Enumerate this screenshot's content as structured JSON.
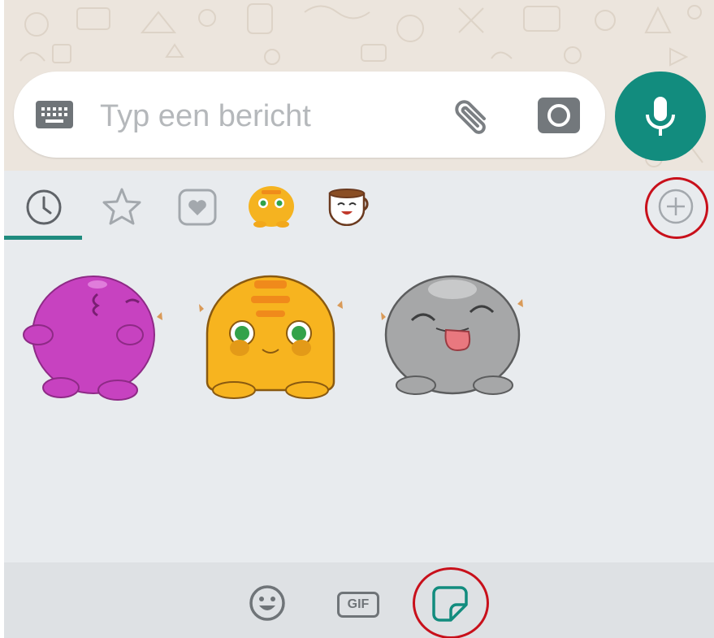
{
  "composer": {
    "placeholder": "Typ een bericht",
    "keyboard_icon": "keyboard-icon",
    "attach_icon": "paperclip-icon",
    "camera_icon": "camera-icon",
    "mic_icon": "microphone-icon"
  },
  "sticker_tabs": [
    {
      "icon": "clock-icon",
      "selected": true
    },
    {
      "icon": "star-icon",
      "selected": false
    },
    {
      "icon": "heart-icon",
      "selected": false
    },
    {
      "icon": "yellow-blob-pack-icon",
      "selected": false
    },
    {
      "icon": "coffee-cup-pack-icon",
      "selected": false
    }
  ],
  "add_pack_icon": "plus-circle-icon",
  "stickers": [
    {
      "icon": "purple-blob-sticker"
    },
    {
      "icon": "yellow-blob-sticker"
    },
    {
      "icon": "gray-blob-sticker"
    }
  ],
  "bottom_bar": {
    "emoji_icon": "emoji-icon",
    "gif_label": "GIF",
    "sticker_icon": "sticker-icon"
  },
  "colors": {
    "accent": "#128c7e",
    "annotation": "#c8101b",
    "panel_bg": "#e8ebee",
    "bottom_bg": "#dee1e4"
  }
}
